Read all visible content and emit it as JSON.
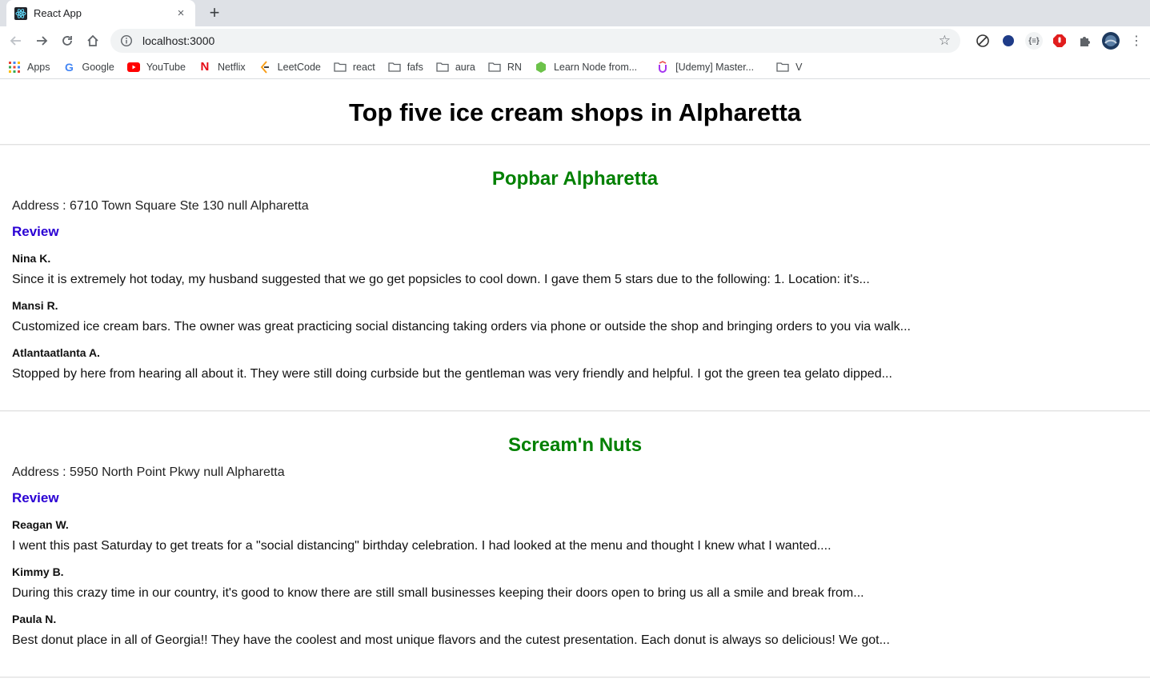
{
  "browser": {
    "tab_title": "React App",
    "close_glyph": "×",
    "new_tab_glyph": "+",
    "url": "localhost:3000",
    "bookmarks": [
      {
        "label": "Apps",
        "icon": "apps-grid-icon"
      },
      {
        "label": "Google",
        "icon": "google-icon"
      },
      {
        "label": "YouTube",
        "icon": "youtube-icon"
      },
      {
        "label": "Netflix",
        "icon": "netflix-icon"
      },
      {
        "label": "LeetCode",
        "icon": "leetcode-icon"
      },
      {
        "label": "react",
        "icon": "folder-icon"
      },
      {
        "label": "fafs",
        "icon": "folder-icon"
      },
      {
        "label": "aura",
        "icon": "folder-icon"
      },
      {
        "label": "RN",
        "icon": "folder-icon"
      },
      {
        "label": "Learn Node from...",
        "icon": "node-icon"
      },
      {
        "label": "[Udemy] Master...",
        "icon": "udemy-icon"
      },
      {
        "label": "V",
        "icon": "folder-icon"
      }
    ]
  },
  "page": {
    "title": "Top five ice cream shops in Alpharetta",
    "shops": [
      {
        "name": "Popbar Alpharetta",
        "address": "Address : 6710 Town Square Ste 130 null Alpharetta",
        "review_heading": "Review",
        "reviews": [
          {
            "author": "Nina K.",
            "text": "Since it is extremely hot today, my husband suggested that we go get popsicles to cool down. I gave them 5 stars due to the following: 1. Location: it's..."
          },
          {
            "author": "Mansi R.",
            "text": "Customized ice cream bars. The owner was great practicing social distancing taking orders via phone or outside the shop and bringing orders to you via walk..."
          },
          {
            "author": "Atlantaatlanta A.",
            "text": "Stopped by here from hearing all about it. They were still doing curbside but the gentleman was very friendly and helpful. I got the green tea gelato dipped..."
          }
        ]
      },
      {
        "name": "Scream'n Nuts",
        "address": "Address : 5950 North Point Pkwy null Alpharetta",
        "review_heading": "Review",
        "reviews": [
          {
            "author": "Reagan W.",
            "text": "I went this past Saturday to get treats for a \"social distancing\" birthday celebration. I had looked at the menu and thought I knew what I wanted...."
          },
          {
            "author": "Kimmy B.",
            "text": "During this crazy time in our country, it's good to know there are still small businesses keeping their doors open to bring us all a smile and break from..."
          },
          {
            "author": "Paula N.",
            "text": "Best donut place in all of Georgia!! They have the coolest and most unique flavors and the cutest presentation. Each donut is always so delicious! We got..."
          }
        ]
      }
    ]
  },
  "colors": {
    "shop_name": "#008000",
    "review_heading": "#2a00d4"
  }
}
